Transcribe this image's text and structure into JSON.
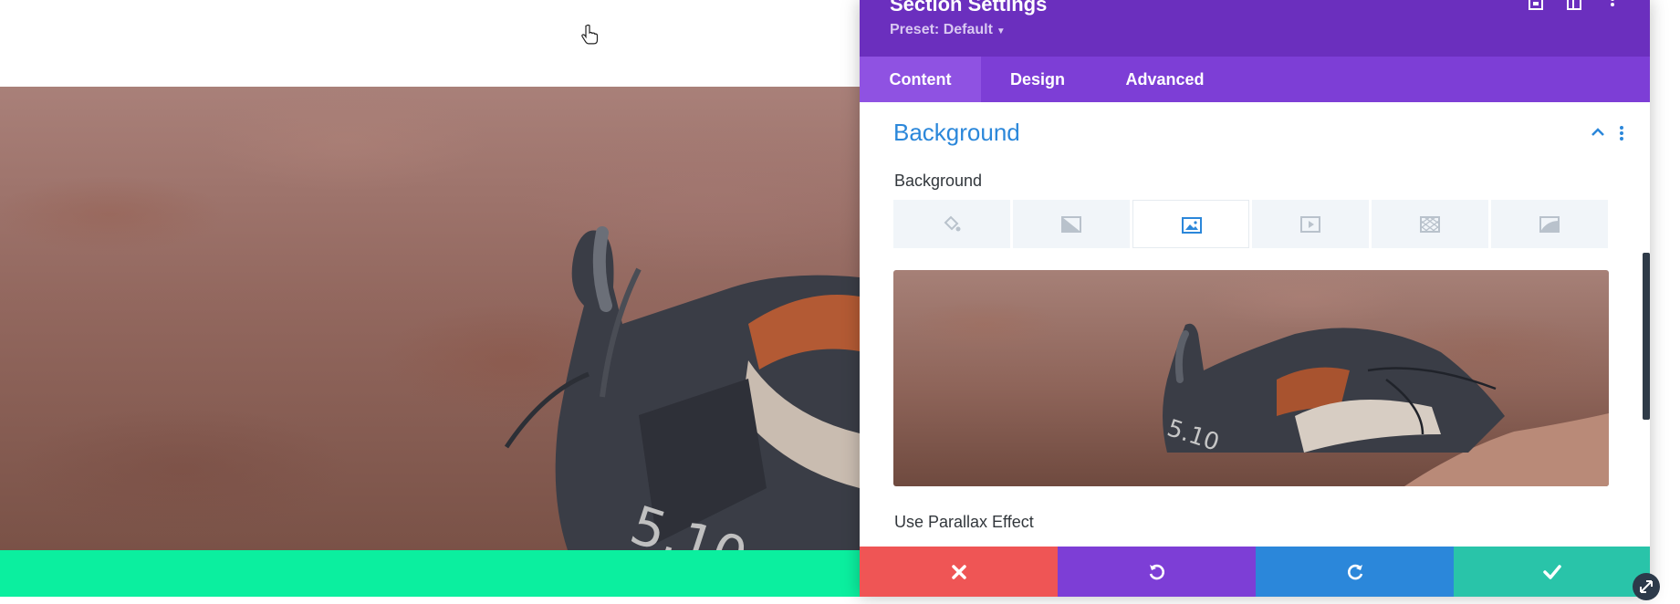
{
  "panel": {
    "title": "Section Settings",
    "preset_label": "Preset: Default",
    "header_icons": [
      "screenshot-icon",
      "columns-icon",
      "more-vertical-icon"
    ]
  },
  "tabs": [
    {
      "label": "Content",
      "active": true
    },
    {
      "label": "Design",
      "active": false
    },
    {
      "label": "Advanced",
      "active": false
    }
  ],
  "background_section": {
    "title": "Background",
    "field_label": "Background",
    "bg_types": [
      {
        "icon": "paint-bucket-icon",
        "active": false
      },
      {
        "icon": "gradient-icon",
        "active": false
      },
      {
        "icon": "image-icon",
        "active": true
      },
      {
        "icon": "video-icon",
        "active": false
      },
      {
        "icon": "pattern-icon",
        "active": false
      },
      {
        "icon": "mask-icon",
        "active": false
      }
    ],
    "next_field_label": "Use Parallax Effect"
  },
  "actions": [
    {
      "icon": "close-icon",
      "color": "#ef5555"
    },
    {
      "icon": "undo-icon",
      "color": "#7d3ed6"
    },
    {
      "icon": "redo-icon",
      "color": "#2b87da"
    },
    {
      "icon": "check-icon",
      "color": "#29c4a9"
    }
  ],
  "colors": {
    "header": "#6b2fbe",
    "tabs_bar": "#7d3ed6",
    "accent_blue": "#2b87da",
    "page_bottom_band": "#0bef9f"
  }
}
